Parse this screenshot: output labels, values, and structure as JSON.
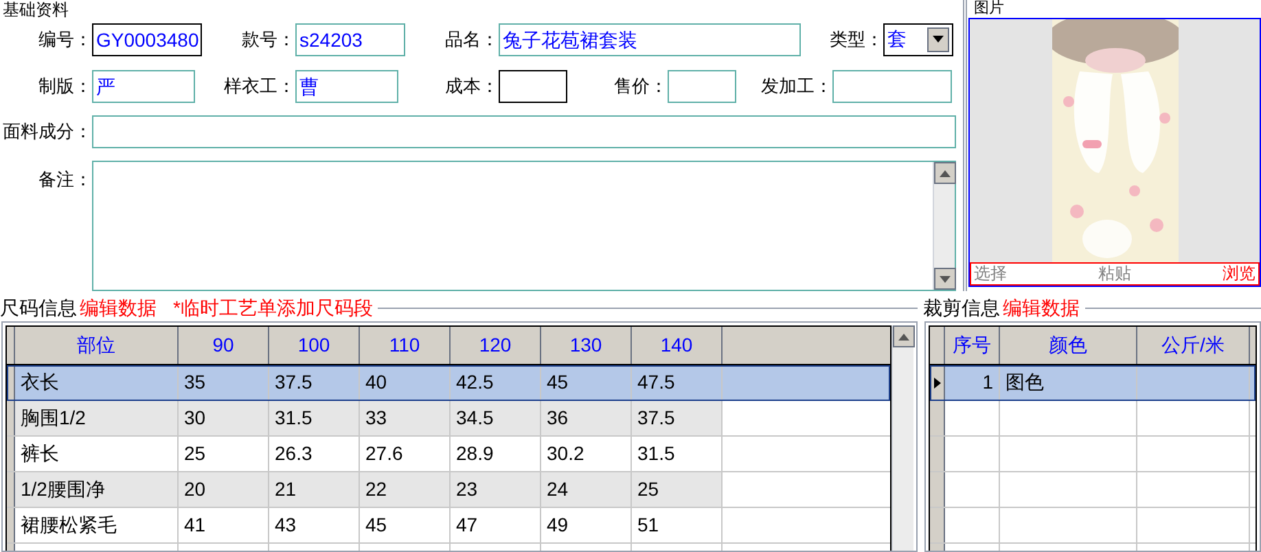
{
  "basic_info": {
    "title": "基础资料",
    "rows": [
      [
        {
          "label": "编号：",
          "value": "GY0003480",
          "color": "#000000"
        },
        {
          "label": "款号：",
          "value": "s24203",
          "color": "#5fb0a8"
        },
        {
          "label": "品名：",
          "value": "兔子花苞裙套装",
          "color": "#5fb0a8"
        },
        {
          "label": "类型：",
          "value": "套",
          "color": "#000000",
          "kind": "combo"
        }
      ],
      [
        {
          "label": "制版：",
          "value": "严",
          "color": "#5fb0a8"
        },
        {
          "label": "样衣工：",
          "value": "曹",
          "color": "#5fb0a8"
        },
        {
          "label": "成本：",
          "color": "#000000"
        },
        {
          "label": "售价：",
          "color": "#5fb0a8"
        },
        {
          "label": "发加工：",
          "color": "#5fb0a8"
        }
      ],
      [
        {
          "label": "面料成分：",
          "color": "#5fb0a8"
        }
      ]
    ],
    "notes": {
      "label": "备注："
    }
  },
  "picture_panel": {
    "title": "图片",
    "buttons": [
      {
        "label": "选择",
        "color": "#808080"
      },
      {
        "label": "粘贴",
        "color": "#808080"
      },
      {
        "label": "浏览",
        "color": "#ff0000"
      }
    ]
  },
  "size_info": {
    "title": "尺码信息",
    "links": [
      "编辑数据",
      "*临时工艺单添加尺码段"
    ],
    "columns": [
      "部位",
      "90",
      "100",
      "110",
      "120",
      "130",
      "140"
    ],
    "rows": [
      {
        "cells": [
          "衣长",
          "35",
          "37.5",
          "40",
          "42.5",
          "45",
          "47.5"
        ],
        "selected": true
      },
      {
        "cells": [
          "胸围1/2",
          "30",
          "31.5",
          "33",
          "34.5",
          "36",
          "37.5"
        ],
        "selected": false
      },
      {
        "cells": [
          "裤长",
          "25",
          "26.3",
          "27.6",
          "28.9",
          "30.2",
          "31.5"
        ],
        "selected": false
      },
      {
        "cells": [
          "1/2腰围净",
          "20",
          "21",
          "22",
          "23",
          "24",
          "25"
        ],
        "selected": false
      },
      {
        "cells": [
          "裙腰松紧毛",
          "41",
          "43",
          "45",
          "47",
          "49",
          "51"
        ],
        "selected": false
      }
    ]
  },
  "cut_info": {
    "title": "裁剪信息",
    "links": [
      "编辑数据"
    ],
    "columns": [
      "序号",
      "颜色",
      "公斤/米"
    ],
    "rows": [
      {
        "cells": [
          "1",
          "图色"
        ],
        "selected": true
      }
    ]
  }
}
